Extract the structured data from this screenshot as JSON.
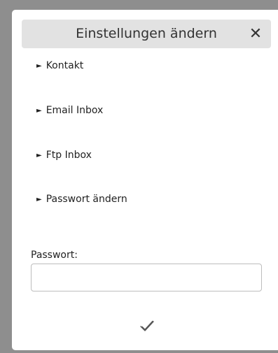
{
  "dialog": {
    "title": "Einstellungen ändern",
    "close_label": "✕",
    "sections": [
      {
        "label": "Kontakt"
      },
      {
        "label": "Email Inbox"
      },
      {
        "label": "Ftp Inbox"
      },
      {
        "label": "Passwort ändern"
      }
    ],
    "password_label": "Passwort:",
    "password_value": "",
    "password_placeholder": ""
  },
  "icons": {
    "close": "close-icon",
    "section_arrow": "triangle-right-icon",
    "confirm": "checkmark-icon"
  },
  "colors": {
    "backdrop": "#8e8e8e",
    "header_bg": "#e2e2e2",
    "dialog_bg": "#ffffff"
  }
}
